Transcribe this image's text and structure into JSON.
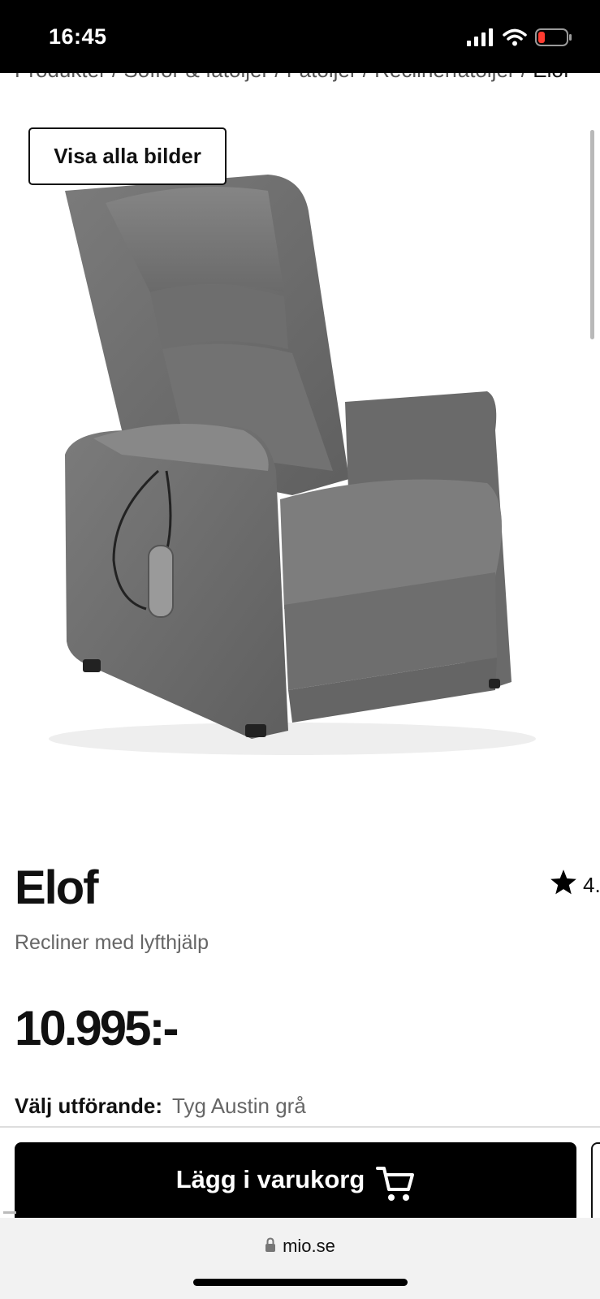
{
  "status_bar": {
    "time": "16:45"
  },
  "breadcrumb": {
    "text": "Produkter / Soffor & fåtöljer / Fåtöljer / Reclinerfåtöljer / ",
    "last": "Elof"
  },
  "gallery": {
    "show_all_label": "Visa alla bilder",
    "image": "Recliner chair in grey fabric with remote"
  },
  "product": {
    "name": "Elof",
    "subtitle": "Recliner med lyfthjälp",
    "rating": "4.",
    "price": "10.995:-",
    "variant_label": "Välj utförande:",
    "variant_value": "Tyg Austin grå"
  },
  "cart": {
    "label": "Lägg i varukorg"
  },
  "browser": {
    "url": "mio.se"
  },
  "colors": {
    "accent": "#000000",
    "muted_text": "#666666",
    "battery_low": "#ff3b30"
  },
  "icons": [
    "signal-icon",
    "wifi-icon",
    "battery-icon",
    "star-icon",
    "cart-icon",
    "lock-icon"
  ]
}
